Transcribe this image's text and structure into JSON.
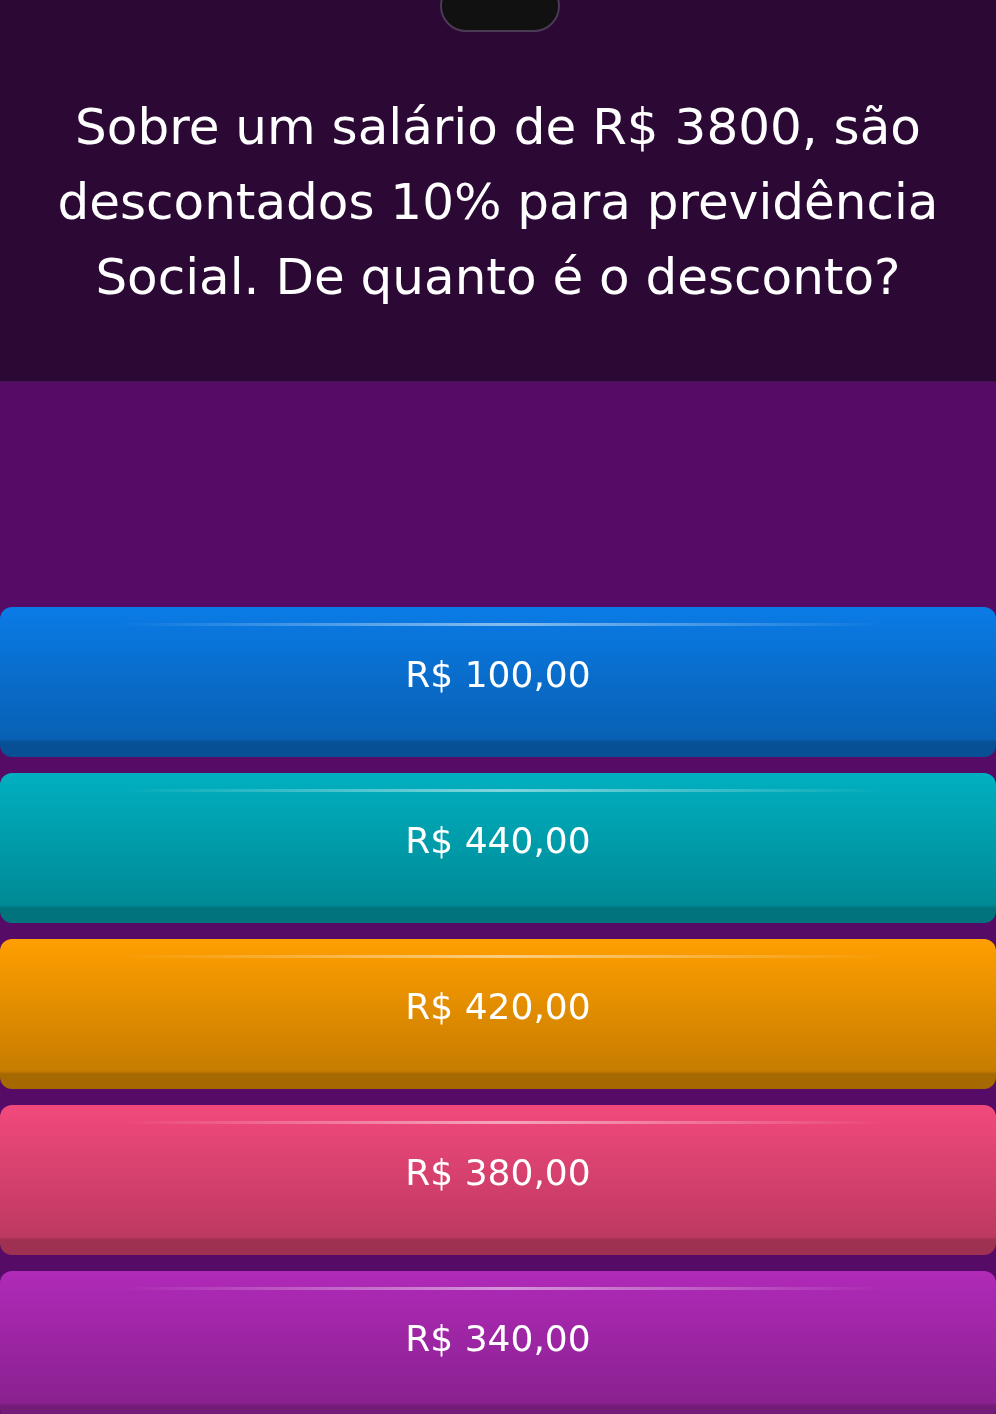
{
  "question": "Sobre um salário de R$ 3800, são descontados 10% para previdência Social. De quanto é o desconto?",
  "options": [
    {
      "label": "R$ 100,00",
      "color": "#0a7be6"
    },
    {
      "label": "R$ 440,00",
      "color": "#00b0c0"
    },
    {
      "label": "R$ 420,00",
      "color": "#ff9f00"
    },
    {
      "label": "R$ 380,00",
      "color": "#f2497c"
    },
    {
      "label": "R$ 340,00",
      "color": "#b02ab8"
    }
  ]
}
